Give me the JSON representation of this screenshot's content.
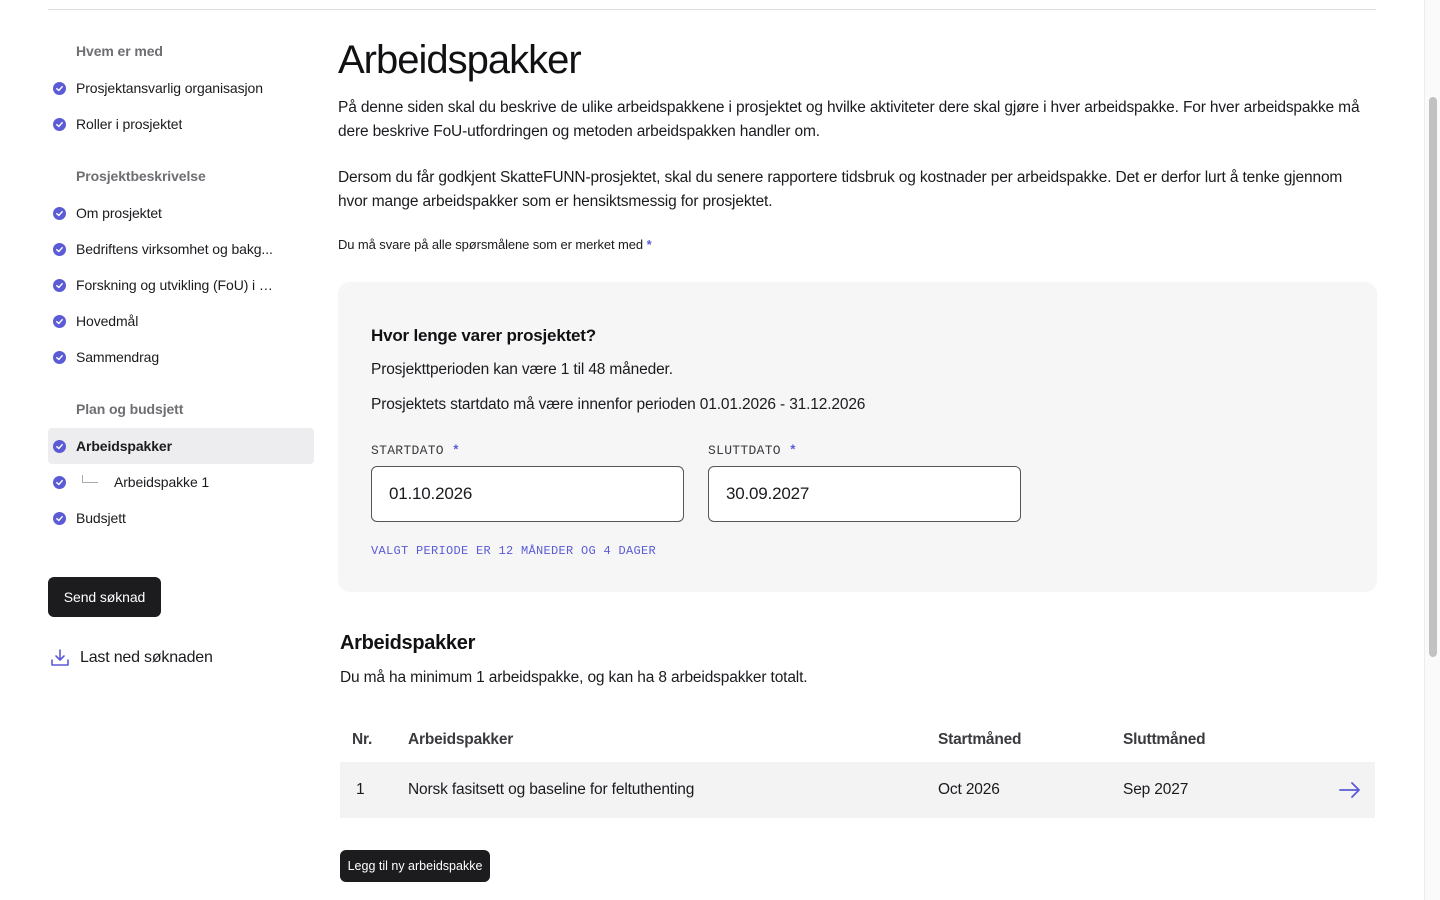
{
  "sidebar": {
    "sections": [
      {
        "heading": "Hvem er med",
        "items": [
          {
            "label": "Prosjektansvarlig organisasjon"
          },
          {
            "label": "Roller i prosjektet"
          }
        ]
      },
      {
        "heading": "Prosjektbeskrivelse",
        "items": [
          {
            "label": "Om prosjektet"
          },
          {
            "label": "Bedriftens virksomhet og bakg..."
          },
          {
            "label": "Forskning og utvikling (FoU) i pr..."
          },
          {
            "label": "Hovedmål"
          },
          {
            "label": "Sammendrag"
          }
        ]
      },
      {
        "heading": "Plan og budsjett",
        "items": [
          {
            "label": "Arbeidspakker"
          },
          {
            "label": "Arbeidspakke 1"
          },
          {
            "label": "Budsjett"
          }
        ]
      }
    ],
    "send_button": "Send søknad",
    "download_link": "Last ned søknaden"
  },
  "main": {
    "title": "Arbeidspakker",
    "intro_1": "På denne siden skal du beskrive de ulike arbeidspakkene i prosjektet og hvilke aktiviteter dere skal gjøre i hver arbeidspakke. For hver arbeidspakke må dere beskrive FoU-utfordringen og metoden arbeidspakken handler om.",
    "intro_2": "Dersom du får godkjent SkatteFUNN-prosjektet, skal du senere rapportere tidsbruk og kostnader per arbeidspakke. Det er derfor lurt å tenke gjennom hvor mange arbeidspakker som er hensiktsmessig for prosjektet.",
    "required_note": "Du må svare på alle spørsmålene som er merket med",
    "required_marker": "*"
  },
  "duration": {
    "title": "Hvor lenge varer prosjektet?",
    "line_1": "Prosjekttperioden kan være 1 til 48 måneder.",
    "line_2": "Prosjektets startdato må være innenfor perioden 01.01.2026 - 31.12.2026",
    "start_label": "STARTDATO",
    "start_value": "01.10.2026",
    "end_label": "SLUTTDATO",
    "end_value": "30.09.2027",
    "period_note": "VALGT PERIODE ER 12 MÅNEDER OG 4 DAGER"
  },
  "workpackages": {
    "title": "Arbeidspakker",
    "subtitle": "Du må ha minimum 1 arbeidspakke, og kan ha 8 arbeidspakker totalt.",
    "columns": [
      "Nr.",
      "Arbeidspakker",
      "Startmåned",
      "Sluttmåned"
    ],
    "rows": [
      {
        "nr": "1",
        "name": "Norsk fasitsett og baseline for feltuthenting",
        "start": "Oct 2026",
        "end": "Sep 2027"
      }
    ],
    "add_button": "Legg til ny arbeidspakke"
  },
  "colors": {
    "accent": "#5b5bd6",
    "dark_button": "#1c1c1e",
    "card_bg": "#f6f6f7"
  }
}
